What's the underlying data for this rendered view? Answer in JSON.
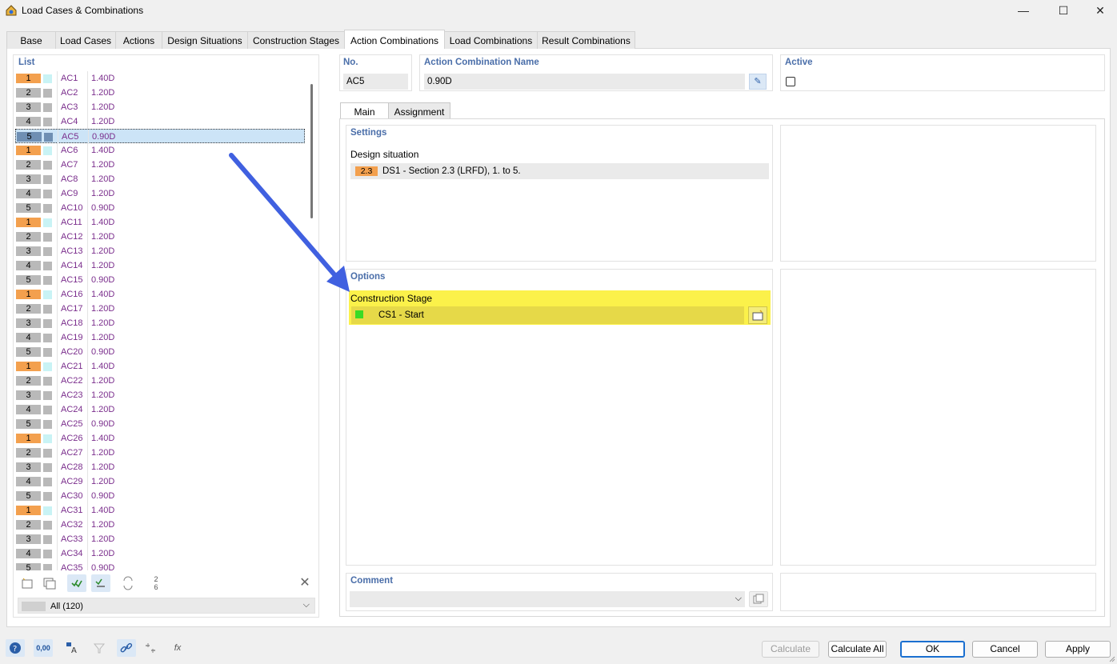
{
  "window": {
    "title": "Load Cases & Combinations",
    "minimize": "—",
    "maximize": "☐",
    "close": "✕"
  },
  "tabs": [
    "Base",
    "Load Cases",
    "Actions",
    "Design Situations",
    "Construction Stages",
    "Action Combinations",
    "Load Combinations",
    "Result Combinations"
  ],
  "active_tab": "Action Combinations",
  "list": {
    "header": "List",
    "selected": "AC5",
    "rows": [
      {
        "num": "1",
        "name": "AC1",
        "val": "1.40D"
      },
      {
        "num": "2",
        "name": "AC2",
        "val": "1.20D"
      },
      {
        "num": "3",
        "name": "AC3",
        "val": "1.20D"
      },
      {
        "num": "4",
        "name": "AC4",
        "val": "1.20D"
      },
      {
        "num": "5",
        "name": "AC5",
        "val": "0.90D"
      },
      {
        "num": "1",
        "name": "AC6",
        "val": "1.40D"
      },
      {
        "num": "2",
        "name": "AC7",
        "val": "1.20D"
      },
      {
        "num": "3",
        "name": "AC8",
        "val": "1.20D"
      },
      {
        "num": "4",
        "name": "AC9",
        "val": "1.20D"
      },
      {
        "num": "5",
        "name": "AC10",
        "val": "0.90D"
      },
      {
        "num": "1",
        "name": "AC11",
        "val": "1.40D"
      },
      {
        "num": "2",
        "name": "AC12",
        "val": "1.20D"
      },
      {
        "num": "3",
        "name": "AC13",
        "val": "1.20D"
      },
      {
        "num": "4",
        "name": "AC14",
        "val": "1.20D"
      },
      {
        "num": "5",
        "name": "AC15",
        "val": "0.90D"
      },
      {
        "num": "1",
        "name": "AC16",
        "val": "1.40D"
      },
      {
        "num": "2",
        "name": "AC17",
        "val": "1.20D"
      },
      {
        "num": "3",
        "name": "AC18",
        "val": "1.20D"
      },
      {
        "num": "4",
        "name": "AC19",
        "val": "1.20D"
      },
      {
        "num": "5",
        "name": "AC20",
        "val": "0.90D"
      },
      {
        "num": "1",
        "name": "AC21",
        "val": "1.40D"
      },
      {
        "num": "2",
        "name": "AC22",
        "val": "1.20D"
      },
      {
        "num": "3",
        "name": "AC23",
        "val": "1.20D"
      },
      {
        "num": "4",
        "name": "AC24",
        "val": "1.20D"
      },
      {
        "num": "5",
        "name": "AC25",
        "val": "0.90D"
      },
      {
        "num": "1",
        "name": "AC26",
        "val": "1.40D"
      },
      {
        "num": "2",
        "name": "AC27",
        "val": "1.20D"
      },
      {
        "num": "3",
        "name": "AC28",
        "val": "1.20D"
      },
      {
        "num": "4",
        "name": "AC29",
        "val": "1.20D"
      },
      {
        "num": "5",
        "name": "AC30",
        "val": "0.90D"
      },
      {
        "num": "1",
        "name": "AC31",
        "val": "1.40D"
      },
      {
        "num": "2",
        "name": "AC32",
        "val": "1.20D"
      },
      {
        "num": "3",
        "name": "AC33",
        "val": "1.20D"
      },
      {
        "num": "4",
        "name": "AC34",
        "val": "1.20D"
      },
      {
        "num": "5",
        "name": "AC35",
        "val": "0.90D"
      }
    ],
    "filter": "All (120)"
  },
  "form": {
    "no_label": "No.",
    "no_value": "AC5",
    "name_label": "Action Combination Name",
    "name_value": "0.90D",
    "active_label": "Active",
    "subtabs": [
      "Main",
      "Assignment"
    ],
    "settings_header": "Settings",
    "design_situation_label": "Design situation",
    "design_situation_badge": "2.3",
    "design_situation_value": "DS1 - Section 2.3 (LRFD), 1. to 5.",
    "options_header": "Options",
    "construction_stage_label": "Construction Stage",
    "construction_stage_value": "CS1 - Start",
    "comment_label": "Comment"
  },
  "buttons": {
    "calculate": "Calculate",
    "calculate_all": "Calculate All",
    "ok": "OK",
    "cancel": "Cancel",
    "apply": "Apply"
  },
  "toolbar_text": {
    "numbers": "2\n6",
    "units": "0,00",
    "function": "fx"
  },
  "colors": {
    "badge_1": "#f3a04e",
    "badge_other": "#b9b9b9",
    "swatch_1": "#c9f3f5",
    "swatch_other": "#b9b9b9",
    "accent": "#4a6ea9",
    "arrow": "#4060e0",
    "highlight": "#fbf14a"
  }
}
